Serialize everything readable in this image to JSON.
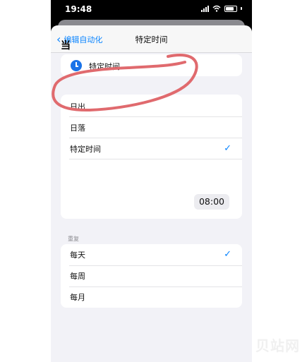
{
  "status": {
    "time": "19:48"
  },
  "nav": {
    "back_label": "编辑自动化",
    "title": "特定时间"
  },
  "section_title": "当",
  "selected_trigger": {
    "label": "特定时间",
    "icon": "clock-icon"
  },
  "trigger_options": [
    {
      "label": "日出",
      "checked": false
    },
    {
      "label": "日落",
      "checked": false
    },
    {
      "label": "特定时间",
      "checked": true
    }
  ],
  "time_value": "08:00",
  "repeat": {
    "header": "重复",
    "options": [
      {
        "label": "每天",
        "checked": true
      },
      {
        "label": "每周",
        "checked": false
      },
      {
        "label": "每月",
        "checked": false
      }
    ]
  },
  "check_glyph": "✓",
  "colors": {
    "accent": "#0a84ff",
    "annotation": "#e06a6e"
  },
  "watermark": "贝站网"
}
